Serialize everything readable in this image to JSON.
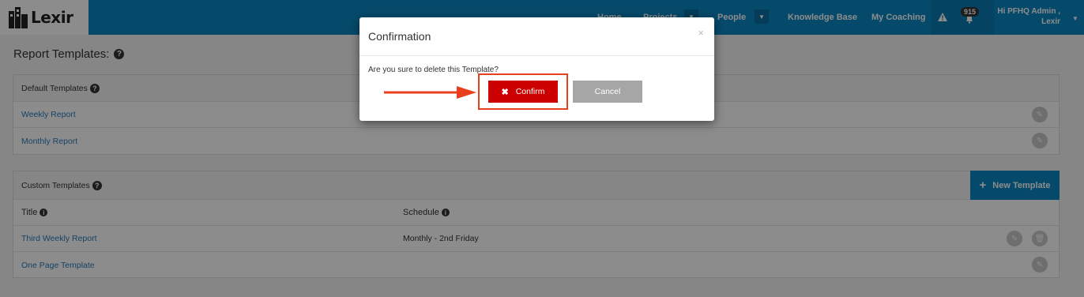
{
  "header": {
    "logo_text": "Lexir",
    "nav": {
      "home": "Home",
      "projects": "Projects",
      "people": "People",
      "knowledge_base": "Knowledge Base",
      "my_coaching": "My Coaching"
    },
    "notification_count": "915",
    "user_line1": "Hi PFHQ Admin ,",
    "user_line2": "Lexir"
  },
  "page": {
    "title": "Report Templates:"
  },
  "default_templates": {
    "heading": "Default Templates",
    "rows": [
      {
        "title": "Weekly Report"
      },
      {
        "title": "Monthly Report"
      }
    ]
  },
  "custom_templates": {
    "heading": "Custom Templates",
    "new_button": "New Template",
    "columns": {
      "title": "Title",
      "schedule": "Schedule"
    },
    "rows": [
      {
        "title": "Third Weekly Report",
        "schedule": "Monthly - 2nd Friday"
      },
      {
        "title": "One Page Template",
        "schedule": ""
      }
    ]
  },
  "modal": {
    "title": "Confirmation",
    "close": "×",
    "message": "Are you sure to delete this Template?",
    "confirm_label": "Confirm",
    "cancel_label": "Cancel"
  },
  "icons": {
    "help": "question-circle-icon",
    "edit": "pencil-icon",
    "delete": "trash-icon",
    "alert": "warning-icon",
    "close": "close-icon",
    "confirm": "x-mark-icon",
    "new": "plus-icon"
  },
  "colors": {
    "brand": "#0c88c4",
    "confirm": "#cc0000",
    "cancel": "#a6a6a6",
    "highlight": "#e8401c"
  }
}
